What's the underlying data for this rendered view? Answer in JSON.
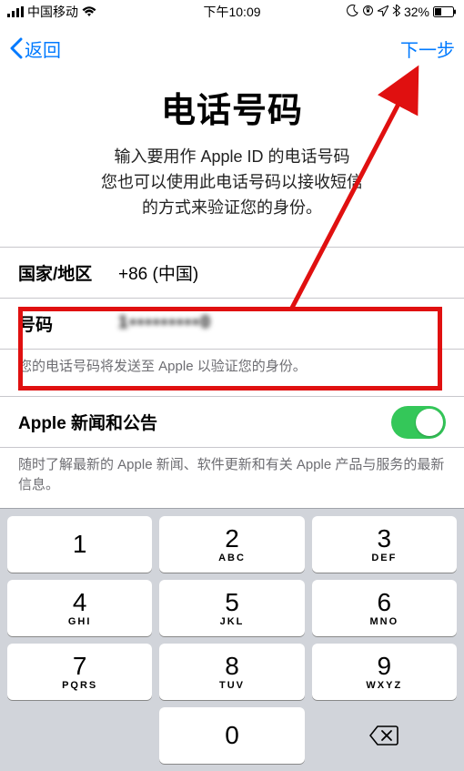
{
  "status": {
    "carrier": "中国移动",
    "time": "下午10:09",
    "battery_pct": "32%"
  },
  "nav": {
    "back": "返回",
    "next": "下一步"
  },
  "title": "电话号码",
  "description": "输入要用作 Apple ID 的电话号码\n您也可以使用此电话号码以接收短信\n的方式来验证您的身份。",
  "region": {
    "label": "国家/地区",
    "value": "+86 (中国)"
  },
  "number": {
    "label": "号码",
    "value": "1•••••••••0"
  },
  "number_footnote": "您的电话号码将发送至 Apple 以验证您的身份。",
  "news": {
    "label": "Apple 新闻和公告",
    "footnote": "随时了解最新的 Apple 新闻、软件更新和有关 Apple 产品与服务的最新信息。"
  },
  "keypad": [
    {
      "d": "1",
      "l": ""
    },
    {
      "d": "2",
      "l": "ABC"
    },
    {
      "d": "3",
      "l": "DEF"
    },
    {
      "d": "4",
      "l": "GHI"
    },
    {
      "d": "5",
      "l": "JKL"
    },
    {
      "d": "6",
      "l": "MNO"
    },
    {
      "d": "7",
      "l": "PQRS"
    },
    {
      "d": "8",
      "l": "TUV"
    },
    {
      "d": "9",
      "l": "WXYZ"
    },
    {
      "d": "",
      "l": ""
    },
    {
      "d": "0",
      "l": ""
    },
    {
      "d": "del",
      "l": ""
    }
  ]
}
